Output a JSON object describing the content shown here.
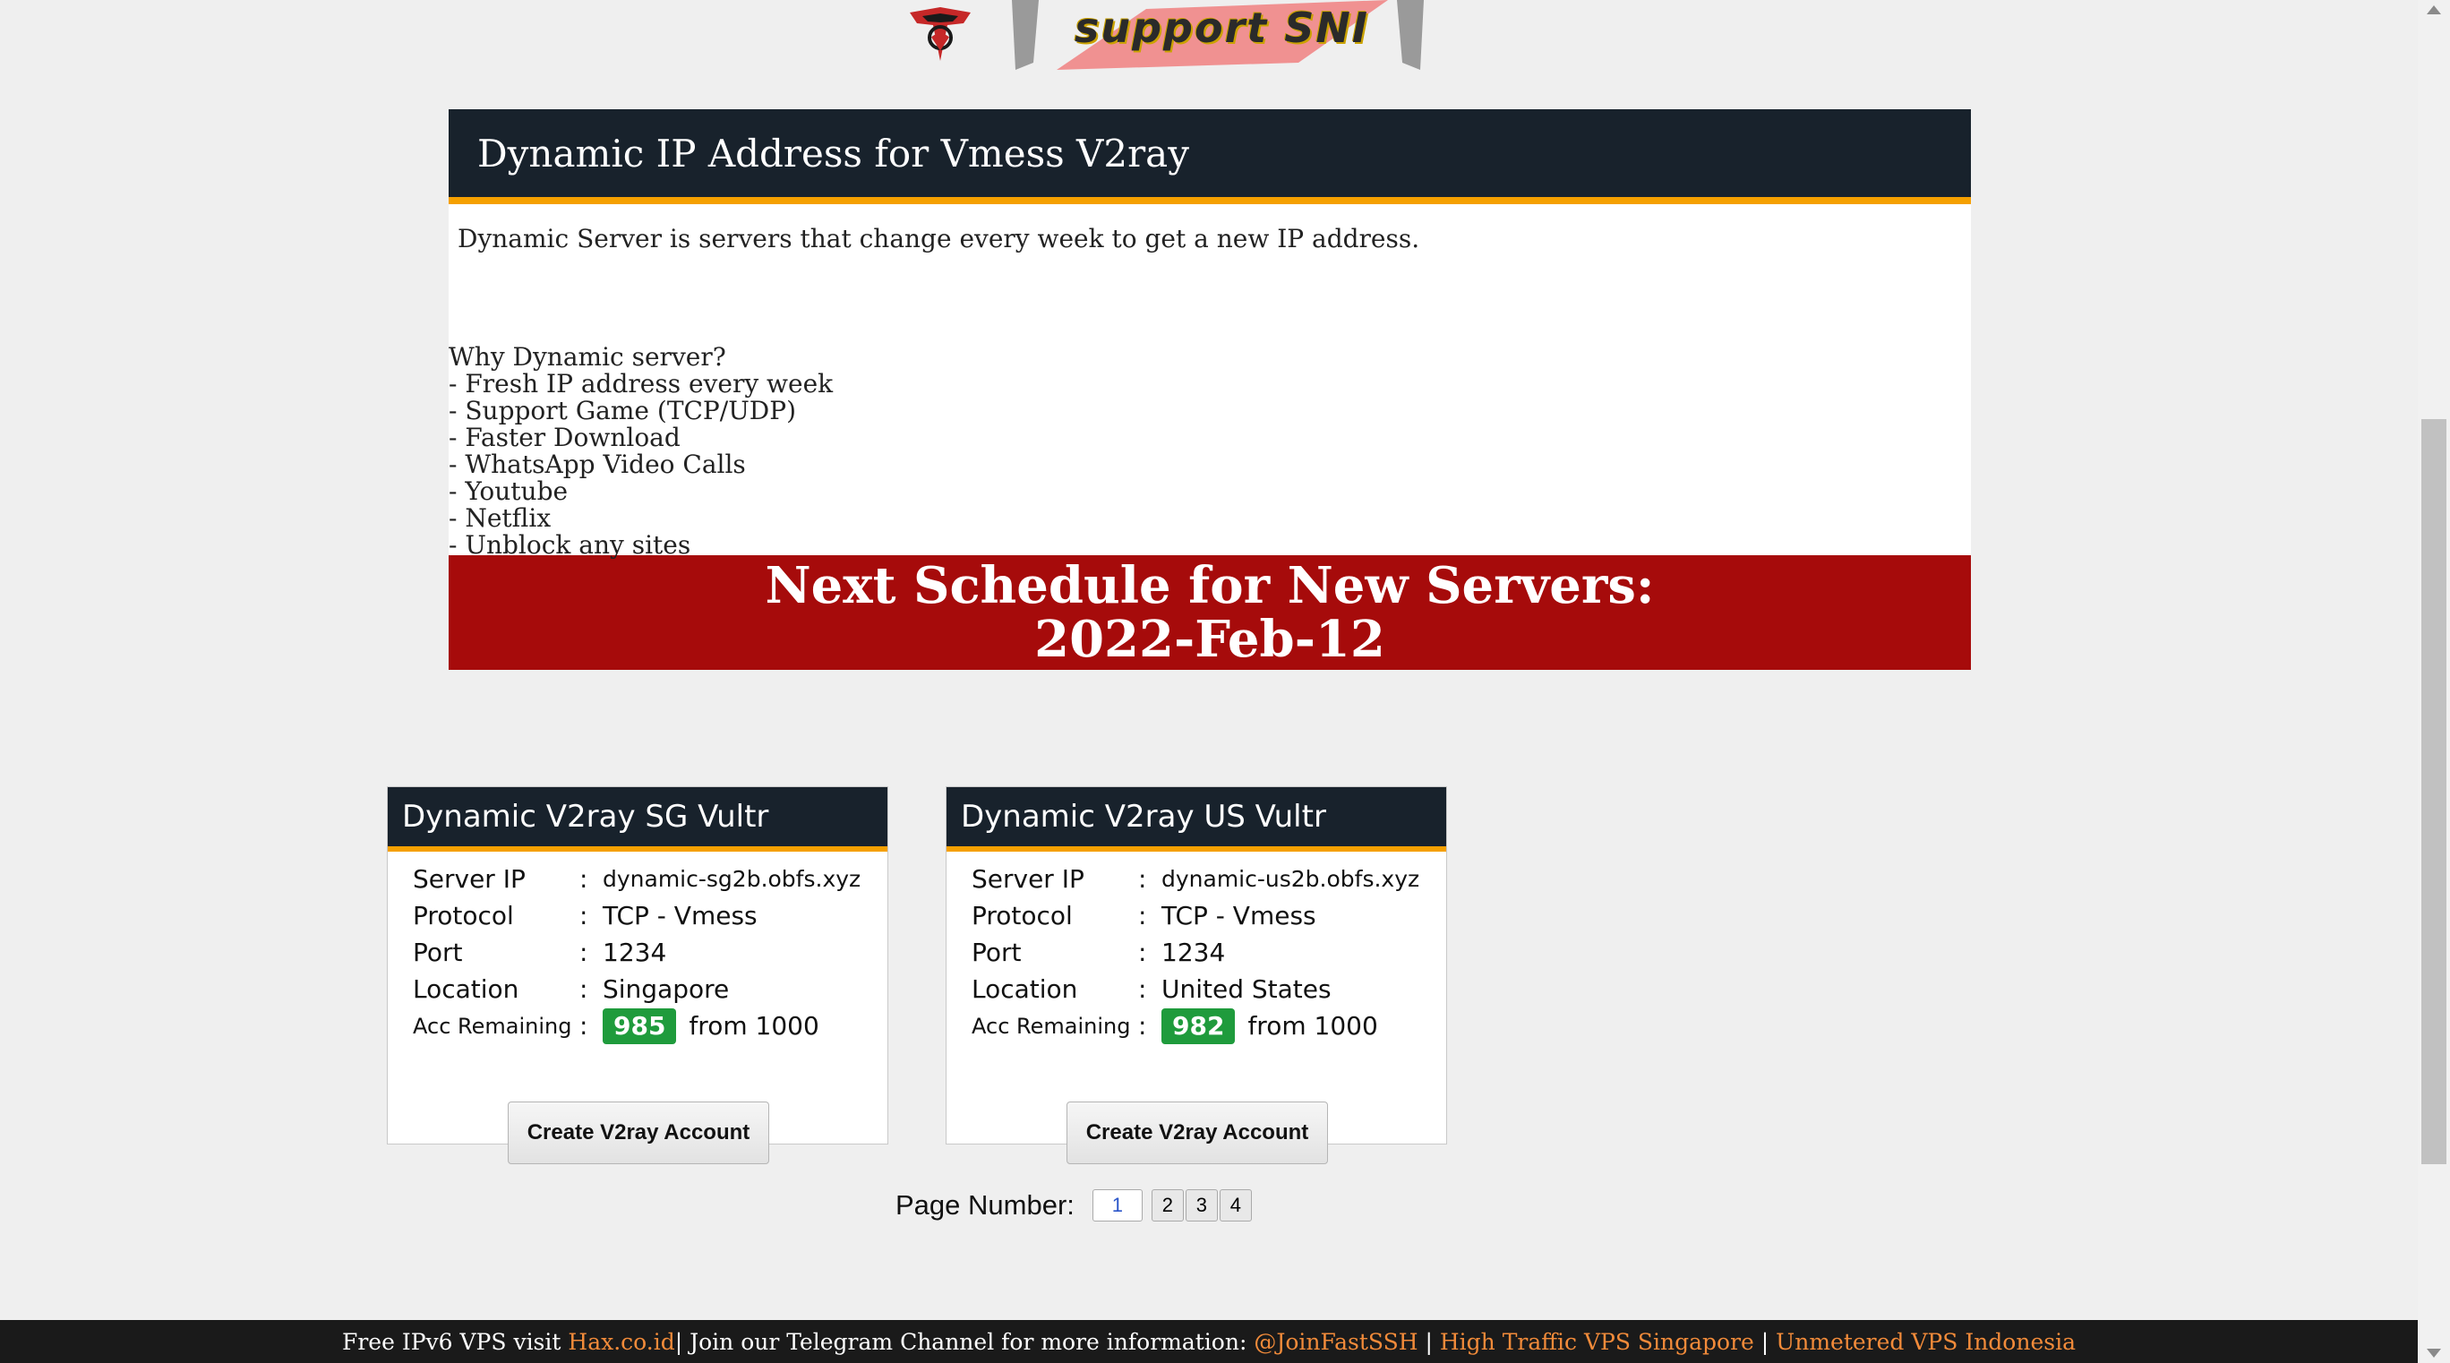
{
  "banner": {
    "text": "support SNI",
    "logo_icon": "shield-logo-icon"
  },
  "main": {
    "title": "Dynamic IP Address for Vmess V2ray",
    "description": "Dynamic Server is servers that change every week to get a new IP address.",
    "why_heading": "Why Dynamic server?",
    "why_items": [
      "- Fresh IP address every week",
      "- Support Game (TCP/UDP)",
      "- Faster Download",
      "- WhatsApp Video Calls",
      "- Youtube",
      "- Netflix",
      "- Unblock any sites"
    ],
    "schedule_line1": "Next Schedule for New Servers:",
    "schedule_line2": "2022-Feb-12"
  },
  "labels": {
    "server_ip": "Server IP",
    "protocol": "Protocol",
    "port": "Port",
    "location": "Location",
    "acc_remaining": "Acc Remaining",
    "colon": ":",
    "from": "from 1000"
  },
  "cards": [
    {
      "title": "Dynamic V2ray SG Vultr",
      "server_ip": "dynamic-sg2b.obfs.xyz",
      "protocol": "TCP - Vmess",
      "port": "1234",
      "location": "Singapore",
      "remaining": "985",
      "button": "Create V2ray Account"
    },
    {
      "title": "Dynamic V2ray US Vultr",
      "server_ip": "dynamic-us2b.obfs.xyz",
      "protocol": "TCP - Vmess",
      "port": "1234",
      "location": "United States",
      "remaining": "982",
      "button": "Create V2ray Account"
    }
  ],
  "pager": {
    "label": "Page Number:",
    "pages": [
      "1",
      "2",
      "3",
      "4"
    ],
    "current": "1"
  },
  "footer": {
    "text1": "Free IPv6 VPS visit ",
    "link1": "Hax.co.id",
    "text2": "| Join our Telegram Channel for more information: ",
    "link2": "@JoinFastSSH",
    "sep": " | ",
    "link3": "High Traffic VPS Singapore",
    "link4": "Unmetered VPS Indonesia"
  },
  "colors": {
    "header_bg": "#18222c",
    "accent": "#f5a000",
    "schedule_bg": "#a60b0b",
    "badge": "#1f9b3c",
    "link": "#f28b3a"
  }
}
